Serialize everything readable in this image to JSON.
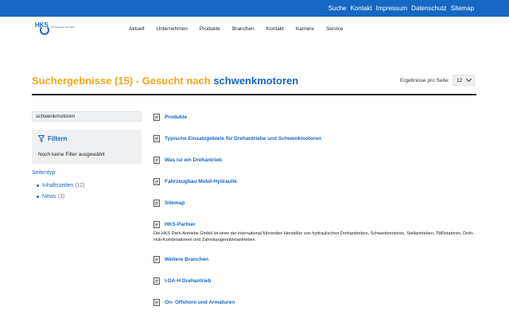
{
  "topbar": {
    "links": [
      "Suche",
      "Kontakt",
      "Impressum",
      "Datenschutz",
      "Sitemap"
    ]
  },
  "logo": {
    "mark": "HKS",
    "tagline": "Wir Bewegen die Welt",
    "color": "#1567c2"
  },
  "nav": {
    "items": [
      "Aktuell",
      "Unternehmen",
      "Produkte",
      "Branchen",
      "Kontakt",
      "Karriere",
      "Service"
    ]
  },
  "heading": {
    "prefix": "Suchergebnisse (15)  -  Gesucht nach",
    "query": "schwenkmotoren",
    "prefix_color": "#f2a81a",
    "query_color": "#1567c2"
  },
  "perpage": {
    "label": "Ergebnisse pro Seite:",
    "value": "12"
  },
  "sidebar": {
    "search_value": "schwenkmotoren",
    "filter_title": "Filtern",
    "no_filter": "Noch keine Filter ausgewählt",
    "facet_title": "Seitentyp",
    "facets": [
      {
        "label": "Inhaltsseiten",
        "count": "(12)"
      },
      {
        "label": "News",
        "count": "(3)"
      }
    ]
  },
  "results": [
    {
      "title": "Produkte",
      "desc": ""
    },
    {
      "title": "Typische Einsatzgebiete für Drehantriebe und Schwenkmotoren",
      "desc": ""
    },
    {
      "title": "Was ist ein Drehantrieb",
      "desc": ""
    },
    {
      "title": "Fahrzeugbau Mobil-Hydraulik",
      "desc": ""
    },
    {
      "title": "Sitemap",
      "desc": ""
    },
    {
      "title": "HKS-Partner",
      "desc": "Die HKS Dreh-Antriebe GmbH ist einer der international führenden Hersteller von hydraulischen Drehantrieben, Schwenkmotoren, Stellantrieben, TiltRotatoren, Dreh-Hub-Kombinationen und Zahnstangenritzelantrieben."
    },
    {
      "title": "Weitere Branchen",
      "desc": ""
    },
    {
      "title": "I-DA-H Drehantrieb",
      "desc": ""
    },
    {
      "title": "On- Offshore und Armaturen",
      "desc": ""
    }
  ],
  "colors": {
    "brand_blue": "#1567c2",
    "accent_orange": "#f2a81a",
    "panel_gray": "#eef0f2"
  }
}
